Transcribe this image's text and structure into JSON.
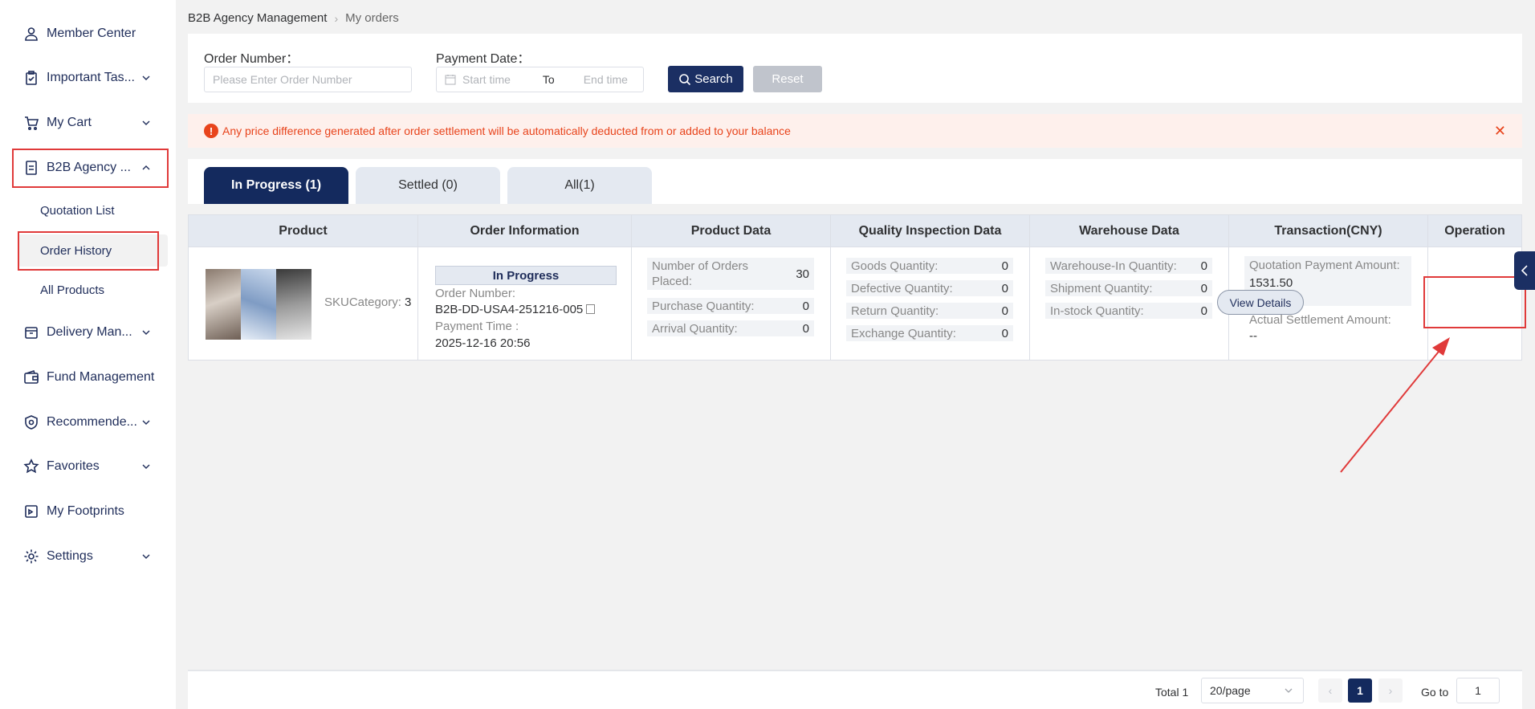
{
  "sidebar": {
    "items": [
      {
        "label": "Member Center",
        "icon": "user-icon"
      },
      {
        "label": "Important Tas...",
        "icon": "clipboard-icon"
      },
      {
        "label": "My Cart",
        "icon": "cart-icon"
      },
      {
        "label": "B2B Agency ...",
        "icon": "document-icon"
      },
      {
        "label": "Delivery Man...",
        "icon": "box-icon"
      },
      {
        "label": "Fund Management",
        "icon": "wallet-icon"
      },
      {
        "label": "Recommende...",
        "icon": "badge-icon"
      },
      {
        "label": "Favorites",
        "icon": "star-icon"
      },
      {
        "label": "My Footprints",
        "icon": "footprint-icon"
      },
      {
        "label": "Settings",
        "icon": "gear-icon"
      }
    ],
    "subitems": [
      {
        "label": "Quotation List"
      },
      {
        "label": "Order History"
      },
      {
        "label": "All Products"
      }
    ]
  },
  "breadcrumb": {
    "root": "B2B Agency Management",
    "current": "My orders"
  },
  "filter": {
    "order_number_label": "Order Number：",
    "order_number_placeholder": "Please Enter Order Number",
    "payment_date_label": "Payment Date：",
    "start_placeholder": "Start time",
    "to_label": "To",
    "end_placeholder": "End time",
    "search_label": "Search",
    "reset_label": "Reset"
  },
  "notice": {
    "text": "Any price difference generated after order settlement will be automatically deducted from or added to your balance"
  },
  "tabs": [
    {
      "label": "In Progress (1)"
    },
    {
      "label": "Settled (0)"
    },
    {
      "label": "All(1)"
    }
  ],
  "table": {
    "headers": [
      "Product",
      "Order Information",
      "Product Data",
      "Quality Inspection Data",
      "Warehouse Data",
      "Transaction(CNY)",
      "Operation"
    ],
    "row": {
      "sku_label": "SKUCategory:",
      "sku_value": "3",
      "status": "In Progress",
      "order_number_label": "Order Number:",
      "order_number": "B2B-DD-USA4-251216-005",
      "payment_time_label": "Payment Time :",
      "payment_time": "2025-12-16 20:56",
      "product_data": [
        {
          "label": "Number of Orders Placed:",
          "value": "30"
        },
        {
          "label": "Purchase Quantity:",
          "value": "0"
        },
        {
          "label": "Arrival Quantity:",
          "value": "0"
        }
      ],
      "quality_data": [
        {
          "label": "Goods Quantity:",
          "value": "0"
        },
        {
          "label": "Defective Quantity:",
          "value": "0"
        },
        {
          "label": "Return Quantity:",
          "value": "0"
        },
        {
          "label": "Exchange Quantity:",
          "value": "0"
        }
      ],
      "warehouse_data": [
        {
          "label": "Warehouse-In Quantity:",
          "value": "0"
        },
        {
          "label": "Shipment Quantity:",
          "value": "0"
        },
        {
          "label": "In-stock Quantity:",
          "value": "0"
        }
      ],
      "transaction": {
        "quotation_label": "Quotation Payment Amount:",
        "quotation_value": "1531.50",
        "actual_label": "Actual Settlement Amount:",
        "actual_value": "--"
      },
      "operation_label": "View Details"
    }
  },
  "pagination": {
    "total": "Total 1",
    "page_size": "20/page",
    "current_page": "1",
    "goto_label": "Go to",
    "goto_value": "1"
  },
  "colors": {
    "primary": "#142a5e",
    "highlight": "#e03a3a",
    "warning": "#e8441c"
  }
}
